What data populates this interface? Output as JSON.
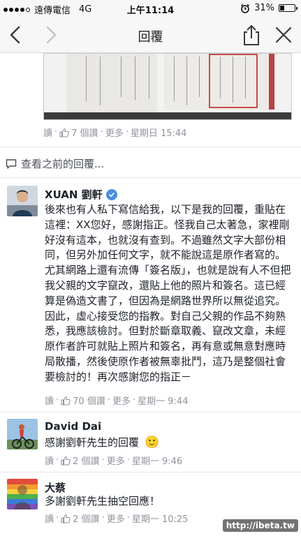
{
  "status_bar": {
    "carrier": "遠傳電信",
    "network": "4G",
    "time": "上午11:14",
    "battery": "31%",
    "battery_level": 0.31
  },
  "nav": {
    "title": "回覆",
    "back_icon": "chevron-left-icon",
    "forward_icon": "chevron-right-icon",
    "share_icon": "share-icon",
    "close_icon": "close-icon"
  },
  "post": {
    "actions": {
      "reply": "讀",
      "likes": "7 個讚",
      "more": "更多",
      "time": "星期日 15:44"
    }
  },
  "see_previous": "查看之前的回覆...",
  "comments": [
    {
      "author": "XUAN 劉軒",
      "verified": true,
      "text": "後來也有人私下寫信給我，以下是我的回覆，重貼在這裡：XX您好，感謝指正。怪我自己太著急，家裡剛好沒有這本，也就沒有查到。不過雖然文字大部份相同，但另外加任何文字，就不能說這是原作者寫的。尤其網路上還有流傳「簽名版」，也就是說有人不但把我父親的文字竄改，還貼上他的照片和簽名。這已經算是偽造文書了，但因為是網路世界所以無從追究。因此，虛心接受您的指教。對自己父親的作品不夠熟悉，我應該檢討。但對於斷章取義、竄改文章，未經原作者許可就貼上照片和簽名，再有意或無意對應時局散播，然後使原作者被無辜批鬥，這乃是整個社會要檢討的！再次感謝您的指正－",
      "actions": {
        "reply": "讀",
        "likes": "70 個讚",
        "more": "更多",
        "time": "星期一 9:44"
      }
    },
    {
      "author": "David Dai",
      "verified": false,
      "text": "感謝劉軒先生的回覆",
      "emoji": "🙂",
      "actions": {
        "reply": "讀",
        "likes": "2 個讚",
        "more": "更多",
        "time": "星期一 9:46"
      }
    },
    {
      "author": "大蔡",
      "verified": false,
      "text": "多謝劉軒先生抽空回應！",
      "actions": {
        "reply": "讀",
        "likes": "2 個讚",
        "more": "更多",
        "time": "星期一 10:25"
      }
    }
  ],
  "watermark": "http://ibeta.tw",
  "colors": {
    "meta_gray": "#90949c",
    "verified_blue": "#4a90e2",
    "bar_bg": "#f7f7f7"
  }
}
